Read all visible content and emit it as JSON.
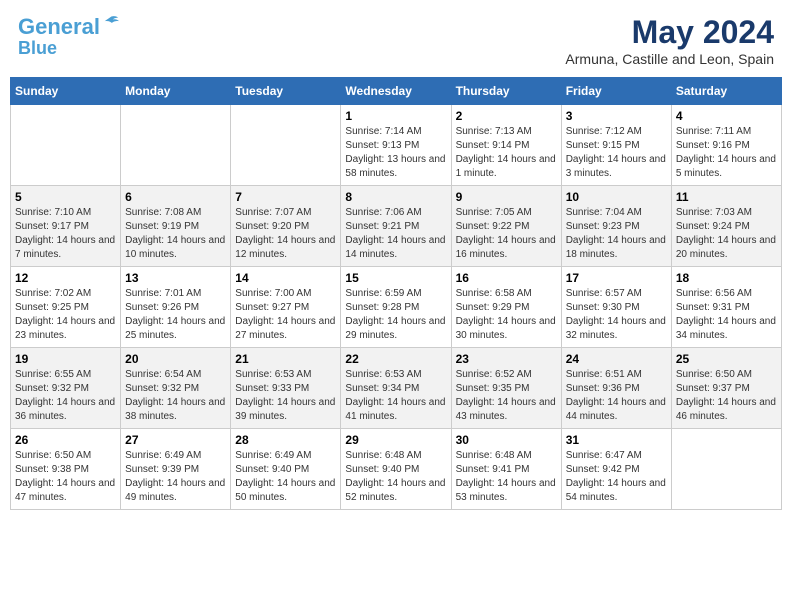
{
  "header": {
    "logo_line1": "General",
    "logo_line2": "Blue",
    "month_title": "May 2024",
    "subtitle": "Armuna, Castille and Leon, Spain"
  },
  "days_of_week": [
    "Sunday",
    "Monday",
    "Tuesday",
    "Wednesday",
    "Thursday",
    "Friday",
    "Saturday"
  ],
  "weeks": [
    [
      {
        "day": "",
        "info": ""
      },
      {
        "day": "",
        "info": ""
      },
      {
        "day": "",
        "info": ""
      },
      {
        "day": "1",
        "info": "Sunrise: 7:14 AM\nSunset: 9:13 PM\nDaylight: 13 hours and 58 minutes."
      },
      {
        "day": "2",
        "info": "Sunrise: 7:13 AM\nSunset: 9:14 PM\nDaylight: 14 hours and 1 minute."
      },
      {
        "day": "3",
        "info": "Sunrise: 7:12 AM\nSunset: 9:15 PM\nDaylight: 14 hours and 3 minutes."
      },
      {
        "day": "4",
        "info": "Sunrise: 7:11 AM\nSunset: 9:16 PM\nDaylight: 14 hours and 5 minutes."
      }
    ],
    [
      {
        "day": "5",
        "info": "Sunrise: 7:10 AM\nSunset: 9:17 PM\nDaylight: 14 hours and 7 minutes."
      },
      {
        "day": "6",
        "info": "Sunrise: 7:08 AM\nSunset: 9:19 PM\nDaylight: 14 hours and 10 minutes."
      },
      {
        "day": "7",
        "info": "Sunrise: 7:07 AM\nSunset: 9:20 PM\nDaylight: 14 hours and 12 minutes."
      },
      {
        "day": "8",
        "info": "Sunrise: 7:06 AM\nSunset: 9:21 PM\nDaylight: 14 hours and 14 minutes."
      },
      {
        "day": "9",
        "info": "Sunrise: 7:05 AM\nSunset: 9:22 PM\nDaylight: 14 hours and 16 minutes."
      },
      {
        "day": "10",
        "info": "Sunrise: 7:04 AM\nSunset: 9:23 PM\nDaylight: 14 hours and 18 minutes."
      },
      {
        "day": "11",
        "info": "Sunrise: 7:03 AM\nSunset: 9:24 PM\nDaylight: 14 hours and 20 minutes."
      }
    ],
    [
      {
        "day": "12",
        "info": "Sunrise: 7:02 AM\nSunset: 9:25 PM\nDaylight: 14 hours and 23 minutes."
      },
      {
        "day": "13",
        "info": "Sunrise: 7:01 AM\nSunset: 9:26 PM\nDaylight: 14 hours and 25 minutes."
      },
      {
        "day": "14",
        "info": "Sunrise: 7:00 AM\nSunset: 9:27 PM\nDaylight: 14 hours and 27 minutes."
      },
      {
        "day": "15",
        "info": "Sunrise: 6:59 AM\nSunset: 9:28 PM\nDaylight: 14 hours and 29 minutes."
      },
      {
        "day": "16",
        "info": "Sunrise: 6:58 AM\nSunset: 9:29 PM\nDaylight: 14 hours and 30 minutes."
      },
      {
        "day": "17",
        "info": "Sunrise: 6:57 AM\nSunset: 9:30 PM\nDaylight: 14 hours and 32 minutes."
      },
      {
        "day": "18",
        "info": "Sunrise: 6:56 AM\nSunset: 9:31 PM\nDaylight: 14 hours and 34 minutes."
      }
    ],
    [
      {
        "day": "19",
        "info": "Sunrise: 6:55 AM\nSunset: 9:32 PM\nDaylight: 14 hours and 36 minutes."
      },
      {
        "day": "20",
        "info": "Sunrise: 6:54 AM\nSunset: 9:32 PM\nDaylight: 14 hours and 38 minutes."
      },
      {
        "day": "21",
        "info": "Sunrise: 6:53 AM\nSunset: 9:33 PM\nDaylight: 14 hours and 39 minutes."
      },
      {
        "day": "22",
        "info": "Sunrise: 6:53 AM\nSunset: 9:34 PM\nDaylight: 14 hours and 41 minutes."
      },
      {
        "day": "23",
        "info": "Sunrise: 6:52 AM\nSunset: 9:35 PM\nDaylight: 14 hours and 43 minutes."
      },
      {
        "day": "24",
        "info": "Sunrise: 6:51 AM\nSunset: 9:36 PM\nDaylight: 14 hours and 44 minutes."
      },
      {
        "day": "25",
        "info": "Sunrise: 6:50 AM\nSunset: 9:37 PM\nDaylight: 14 hours and 46 minutes."
      }
    ],
    [
      {
        "day": "26",
        "info": "Sunrise: 6:50 AM\nSunset: 9:38 PM\nDaylight: 14 hours and 47 minutes."
      },
      {
        "day": "27",
        "info": "Sunrise: 6:49 AM\nSunset: 9:39 PM\nDaylight: 14 hours and 49 minutes."
      },
      {
        "day": "28",
        "info": "Sunrise: 6:49 AM\nSunset: 9:40 PM\nDaylight: 14 hours and 50 minutes."
      },
      {
        "day": "29",
        "info": "Sunrise: 6:48 AM\nSunset: 9:40 PM\nDaylight: 14 hours and 52 minutes."
      },
      {
        "day": "30",
        "info": "Sunrise: 6:48 AM\nSunset: 9:41 PM\nDaylight: 14 hours and 53 minutes."
      },
      {
        "day": "31",
        "info": "Sunrise: 6:47 AM\nSunset: 9:42 PM\nDaylight: 14 hours and 54 minutes."
      },
      {
        "day": "",
        "info": ""
      }
    ]
  ]
}
